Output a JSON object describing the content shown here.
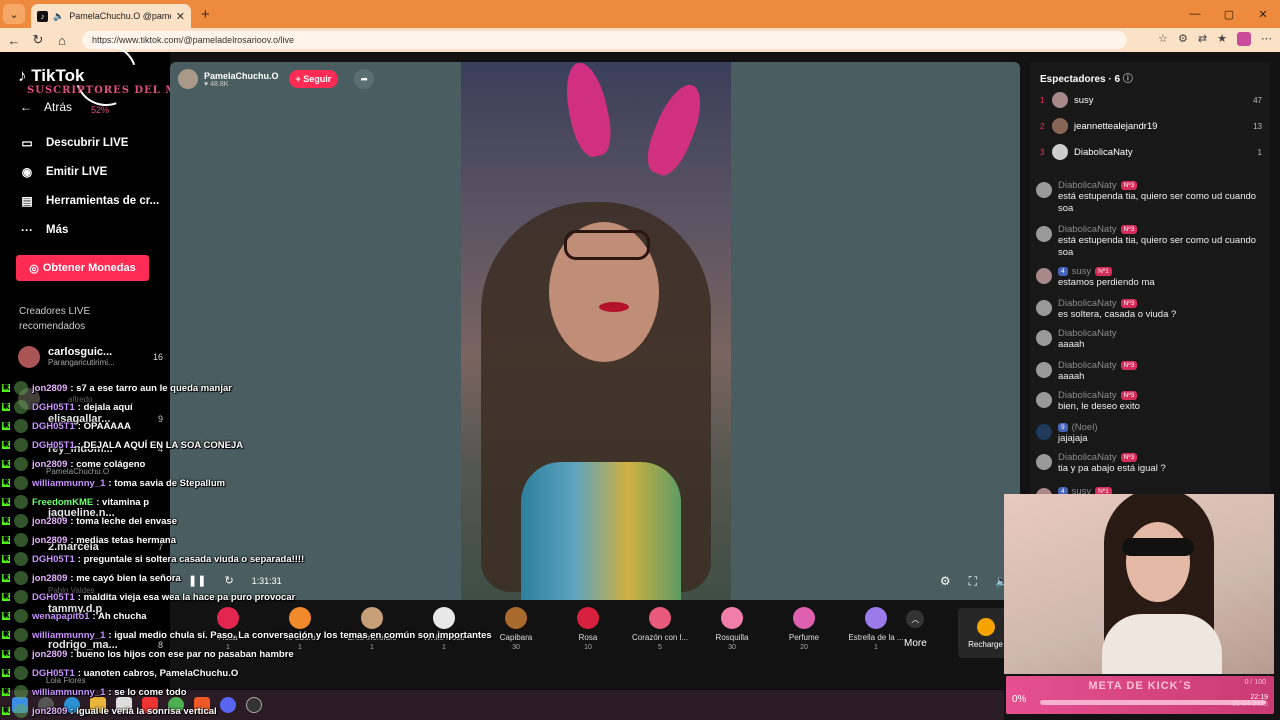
{
  "browser": {
    "tab_title": "PamelaChuchu.O @pameladelrosariov.o",
    "url": "https://www.tiktok.com/@pameladelrosarioov.o/live"
  },
  "sidebar": {
    "logo": "TikTok",
    "overlay_title": "SUSCRIPTORES DEL MES",
    "overlay_pct": "52%",
    "back": "Atrás",
    "items": [
      {
        "label": "Descubrir LIVE",
        "icon": "tv-icon"
      },
      {
        "label": "Emitir LIVE",
        "icon": "camera-icon"
      },
      {
        "label": "Herramientas de cr...",
        "icon": "tools-icon"
      },
      {
        "label": "Más",
        "icon": "more-icon"
      }
    ],
    "coins_button": "Obtener Monedas",
    "recommended_title": "Creadores LIVE recomendados",
    "creators": [
      {
        "name": "carlosguic...",
        "sub": "Parangaricutirimi...",
        "count": "16"
      },
      {
        "name": "alfredo",
        "sub": "",
        "count": ""
      },
      {
        "name": "elisagallar...",
        "sub": "",
        "count": "9"
      },
      {
        "name": "rey_indom...",
        "sub": "",
        "count": "4"
      },
      {
        "name": "jaqueline.n...",
        "sub": "",
        "count": ""
      },
      {
        "name": "2.marcela",
        "sub": "Pablo Valdes",
        "count": "7"
      },
      {
        "name": "tammy.d.p",
        "sub": "",
        "count": ""
      },
      {
        "name": "rodrigo_ma...",
        "sub": "",
        "count": "8"
      }
    ]
  },
  "stage": {
    "host_name": "PamelaChuchu.O",
    "host_likes": "♥ 48.8K",
    "follow": "+ Seguir",
    "time": "1:31:31"
  },
  "gifts": [
    {
      "name": "Rosa",
      "price": "1",
      "color": "#e3264f"
    },
    {
      "name": "Te adoro",
      "price": "1",
      "color": "#f08a2c"
    },
    {
      "name": "Eres increíble",
      "price": "1",
      "color": "#c7a07a"
    },
    {
      "name": "White Rose",
      "price": "1",
      "color": "#e8e8e8"
    },
    {
      "name": "Capibara",
      "price": "30",
      "color": "#a86a2d"
    },
    {
      "name": "Rosa",
      "price": "10",
      "color": "#d8213f"
    },
    {
      "name": "Corazón con l...",
      "price": "5",
      "color": "#e85a7a"
    },
    {
      "name": "Rosquilla",
      "price": "30",
      "color": "#f07ea8"
    },
    {
      "name": "Perfume",
      "price": "20",
      "color": "#e060b0"
    },
    {
      "name": "Estrella de la ...",
      "price": "1",
      "color": "#9b7bea"
    }
  ],
  "gift_more": "More",
  "recharge": "Recharge",
  "viewers": {
    "title": "Espectadores · 6",
    "list": [
      {
        "rank": "1",
        "name": "susy",
        "points": "47"
      },
      {
        "rank": "2",
        "name": "jeannettealejandr19",
        "points": "13"
      },
      {
        "rank": "3",
        "name": "DiabolicaNaty",
        "points": "1"
      }
    ]
  },
  "chat": [
    {
      "user": "DiabolicaNaty",
      "badge": "Nº3",
      "text": "está estupenda tia, quiero ser como ud cuando soa"
    },
    {
      "user": "DiabolicaNaty",
      "badge": "Nº3",
      "text": "está estupenda tia, quiero ser como ud cuando soa"
    },
    {
      "user": "susy",
      "badge": "Nº1",
      "level": "4",
      "text": "estamos perdiendo ma"
    },
    {
      "user": "DiabolicaNaty",
      "badge": "Nº3",
      "text": "es soltera, casada o viuda ?"
    },
    {
      "user": "DiabolicaNaty",
      "badge": "",
      "text": "aaaah"
    },
    {
      "user": "DiabolicaNaty",
      "badge": "Nº3",
      "text": "aaaah"
    },
    {
      "user": "DiabolicaNaty",
      "badge": "Nº3",
      "text": "bien, le deseo exito"
    },
    {
      "user": "(Noel)",
      "badge": "",
      "level": "9",
      "text": "jajajaja"
    },
    {
      "user": "DiabolicaNaty",
      "badge": "Nº3",
      "text": "tia y pa abajo está igual ?"
    },
    {
      "user": "susy",
      "badge": "Nº1",
      "level": "4",
      "text": ""
    }
  ],
  "goal": {
    "title": "META DE KICK´S",
    "percent": "0%",
    "progress": 0,
    "count": "0 / 100",
    "clock_time": "22:19",
    "clock_date": "21-04-2025"
  },
  "overlay_chat": [
    {
      "name": "jon2809",
      "color": "#e6b0ff",
      "text": ": s7 a ese tarro aun le queda manjar",
      "ghost": ""
    },
    {
      "name": "DGH05T1",
      "color": "#c792ff",
      "text": ": dejala aquí",
      "ghost": ""
    },
    {
      "name": "DGH05T1",
      "color": "#c792ff",
      "text": ": OPAAAAA",
      "ghost": ""
    },
    {
      "name": "DGH05T1",
      "color": "#c792ff",
      "text": ": DEJALA AQUÍ EN LA SOA CONEJA",
      "ghost": ""
    },
    {
      "name": "jon2809",
      "color": "#e6b0ff",
      "text": ": come colágeno",
      "ghost": ""
    },
    {
      "name": "williammunny_1",
      "color": "#c792ff",
      "text": ": toma savia de Stepallum",
      "ghost": "PamelaChuchu.O"
    },
    {
      "name": "FreedomKME",
      "color": "#6dff6d",
      "text": ": vitamina p",
      "ghost": ""
    },
    {
      "name": "jon2809",
      "color": "#e6b0ff",
      "text": ": toma leche del envase",
      "ghost": ""
    },
    {
      "name": "jon2809",
      "color": "#e6b0ff",
      "text": ": medias tetas hermana",
      "ghost": ""
    },
    {
      "name": "DGH05T1",
      "color": "#c792ff",
      "text": ": preguntale si soltera casada viuda o separada!!!!",
      "ghost": ""
    },
    {
      "name": "jon2809",
      "color": "#e6b0ff",
      "text": ": me cayó bien la señora",
      "ghost": ""
    },
    {
      "name": "DGH05T1",
      "color": "#c792ff",
      "text": ": maldita vieja esa wea la hace pa puro provocar",
      "ghost": ""
    },
    {
      "name": "wenapapito1",
      "color": "#c792ff",
      "text": ": Ah chucha",
      "ghost": ""
    },
    {
      "name": "williammunny_1",
      "color": "#c792ff",
      "text": ": igual medio chula sí. Paso. La conversación y los temas en común son importantes",
      "ghost": ""
    },
    {
      "name": "jon2809",
      "color": "#e6b0ff",
      "text": ": bueno los hijos con ese par no pasaban hambre",
      "ghost": ""
    },
    {
      "name": "DGH05T1",
      "color": "#c792ff",
      "text": ": uanoten cabros, PamelaChuchu.O",
      "ghost": ""
    },
    {
      "name": "williammunny_1",
      "color": "#c792ff",
      "text": ": se lo come todo",
      "ghost": "Lola Flores"
    },
    {
      "name": "jon2809",
      "color": "#e6b0ff",
      "text": ": igual le vería la sonrisa vertical",
      "ghost": ""
    }
  ]
}
